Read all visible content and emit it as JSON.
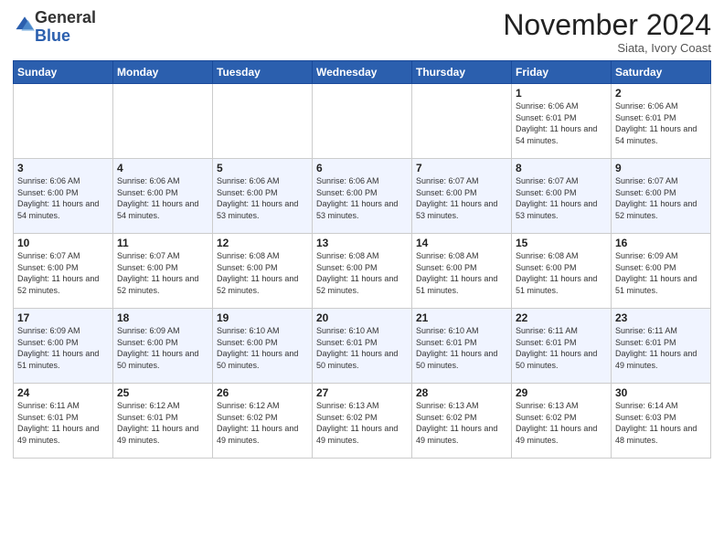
{
  "logo": {
    "general": "General",
    "blue": "Blue"
  },
  "header": {
    "month_title": "November 2024",
    "location": "Siata, Ivory Coast"
  },
  "weekdays": [
    "Sunday",
    "Monday",
    "Tuesday",
    "Wednesday",
    "Thursday",
    "Friday",
    "Saturday"
  ],
  "weeks": [
    [
      {
        "day": "",
        "sunrise": "",
        "sunset": "",
        "daylight": ""
      },
      {
        "day": "",
        "sunrise": "",
        "sunset": "",
        "daylight": ""
      },
      {
        "day": "",
        "sunrise": "",
        "sunset": "",
        "daylight": ""
      },
      {
        "day": "",
        "sunrise": "",
        "sunset": "",
        "daylight": ""
      },
      {
        "day": "",
        "sunrise": "",
        "sunset": "",
        "daylight": ""
      },
      {
        "day": "1",
        "sunrise": "Sunrise: 6:06 AM",
        "sunset": "Sunset: 6:01 PM",
        "daylight": "Daylight: 11 hours and 54 minutes."
      },
      {
        "day": "2",
        "sunrise": "Sunrise: 6:06 AM",
        "sunset": "Sunset: 6:01 PM",
        "daylight": "Daylight: 11 hours and 54 minutes."
      }
    ],
    [
      {
        "day": "3",
        "sunrise": "Sunrise: 6:06 AM",
        "sunset": "Sunset: 6:00 PM",
        "daylight": "Daylight: 11 hours and 54 minutes."
      },
      {
        "day": "4",
        "sunrise": "Sunrise: 6:06 AM",
        "sunset": "Sunset: 6:00 PM",
        "daylight": "Daylight: 11 hours and 54 minutes."
      },
      {
        "day": "5",
        "sunrise": "Sunrise: 6:06 AM",
        "sunset": "Sunset: 6:00 PM",
        "daylight": "Daylight: 11 hours and 53 minutes."
      },
      {
        "day": "6",
        "sunrise": "Sunrise: 6:06 AM",
        "sunset": "Sunset: 6:00 PM",
        "daylight": "Daylight: 11 hours and 53 minutes."
      },
      {
        "day": "7",
        "sunrise": "Sunrise: 6:07 AM",
        "sunset": "Sunset: 6:00 PM",
        "daylight": "Daylight: 11 hours and 53 minutes."
      },
      {
        "day": "8",
        "sunrise": "Sunrise: 6:07 AM",
        "sunset": "Sunset: 6:00 PM",
        "daylight": "Daylight: 11 hours and 53 minutes."
      },
      {
        "day": "9",
        "sunrise": "Sunrise: 6:07 AM",
        "sunset": "Sunset: 6:00 PM",
        "daylight": "Daylight: 11 hours and 52 minutes."
      }
    ],
    [
      {
        "day": "10",
        "sunrise": "Sunrise: 6:07 AM",
        "sunset": "Sunset: 6:00 PM",
        "daylight": "Daylight: 11 hours and 52 minutes."
      },
      {
        "day": "11",
        "sunrise": "Sunrise: 6:07 AM",
        "sunset": "Sunset: 6:00 PM",
        "daylight": "Daylight: 11 hours and 52 minutes."
      },
      {
        "day": "12",
        "sunrise": "Sunrise: 6:08 AM",
        "sunset": "Sunset: 6:00 PM",
        "daylight": "Daylight: 11 hours and 52 minutes."
      },
      {
        "day": "13",
        "sunrise": "Sunrise: 6:08 AM",
        "sunset": "Sunset: 6:00 PM",
        "daylight": "Daylight: 11 hours and 52 minutes."
      },
      {
        "day": "14",
        "sunrise": "Sunrise: 6:08 AM",
        "sunset": "Sunset: 6:00 PM",
        "daylight": "Daylight: 11 hours and 51 minutes."
      },
      {
        "day": "15",
        "sunrise": "Sunrise: 6:08 AM",
        "sunset": "Sunset: 6:00 PM",
        "daylight": "Daylight: 11 hours and 51 minutes."
      },
      {
        "day": "16",
        "sunrise": "Sunrise: 6:09 AM",
        "sunset": "Sunset: 6:00 PM",
        "daylight": "Daylight: 11 hours and 51 minutes."
      }
    ],
    [
      {
        "day": "17",
        "sunrise": "Sunrise: 6:09 AM",
        "sunset": "Sunset: 6:00 PM",
        "daylight": "Daylight: 11 hours and 51 minutes."
      },
      {
        "day": "18",
        "sunrise": "Sunrise: 6:09 AM",
        "sunset": "Sunset: 6:00 PM",
        "daylight": "Daylight: 11 hours and 50 minutes."
      },
      {
        "day": "19",
        "sunrise": "Sunrise: 6:10 AM",
        "sunset": "Sunset: 6:00 PM",
        "daylight": "Daylight: 11 hours and 50 minutes."
      },
      {
        "day": "20",
        "sunrise": "Sunrise: 6:10 AM",
        "sunset": "Sunset: 6:01 PM",
        "daylight": "Daylight: 11 hours and 50 minutes."
      },
      {
        "day": "21",
        "sunrise": "Sunrise: 6:10 AM",
        "sunset": "Sunset: 6:01 PM",
        "daylight": "Daylight: 11 hours and 50 minutes."
      },
      {
        "day": "22",
        "sunrise": "Sunrise: 6:11 AM",
        "sunset": "Sunset: 6:01 PM",
        "daylight": "Daylight: 11 hours and 50 minutes."
      },
      {
        "day": "23",
        "sunrise": "Sunrise: 6:11 AM",
        "sunset": "Sunset: 6:01 PM",
        "daylight": "Daylight: 11 hours and 49 minutes."
      }
    ],
    [
      {
        "day": "24",
        "sunrise": "Sunrise: 6:11 AM",
        "sunset": "Sunset: 6:01 PM",
        "daylight": "Daylight: 11 hours and 49 minutes."
      },
      {
        "day": "25",
        "sunrise": "Sunrise: 6:12 AM",
        "sunset": "Sunset: 6:01 PM",
        "daylight": "Daylight: 11 hours and 49 minutes."
      },
      {
        "day": "26",
        "sunrise": "Sunrise: 6:12 AM",
        "sunset": "Sunset: 6:02 PM",
        "daylight": "Daylight: 11 hours and 49 minutes."
      },
      {
        "day": "27",
        "sunrise": "Sunrise: 6:13 AM",
        "sunset": "Sunset: 6:02 PM",
        "daylight": "Daylight: 11 hours and 49 minutes."
      },
      {
        "day": "28",
        "sunrise": "Sunrise: 6:13 AM",
        "sunset": "Sunset: 6:02 PM",
        "daylight": "Daylight: 11 hours and 49 minutes."
      },
      {
        "day": "29",
        "sunrise": "Sunrise: 6:13 AM",
        "sunset": "Sunset: 6:02 PM",
        "daylight": "Daylight: 11 hours and 49 minutes."
      },
      {
        "day": "30",
        "sunrise": "Sunrise: 6:14 AM",
        "sunset": "Sunset: 6:03 PM",
        "daylight": "Daylight: 11 hours and 48 minutes."
      }
    ]
  ]
}
